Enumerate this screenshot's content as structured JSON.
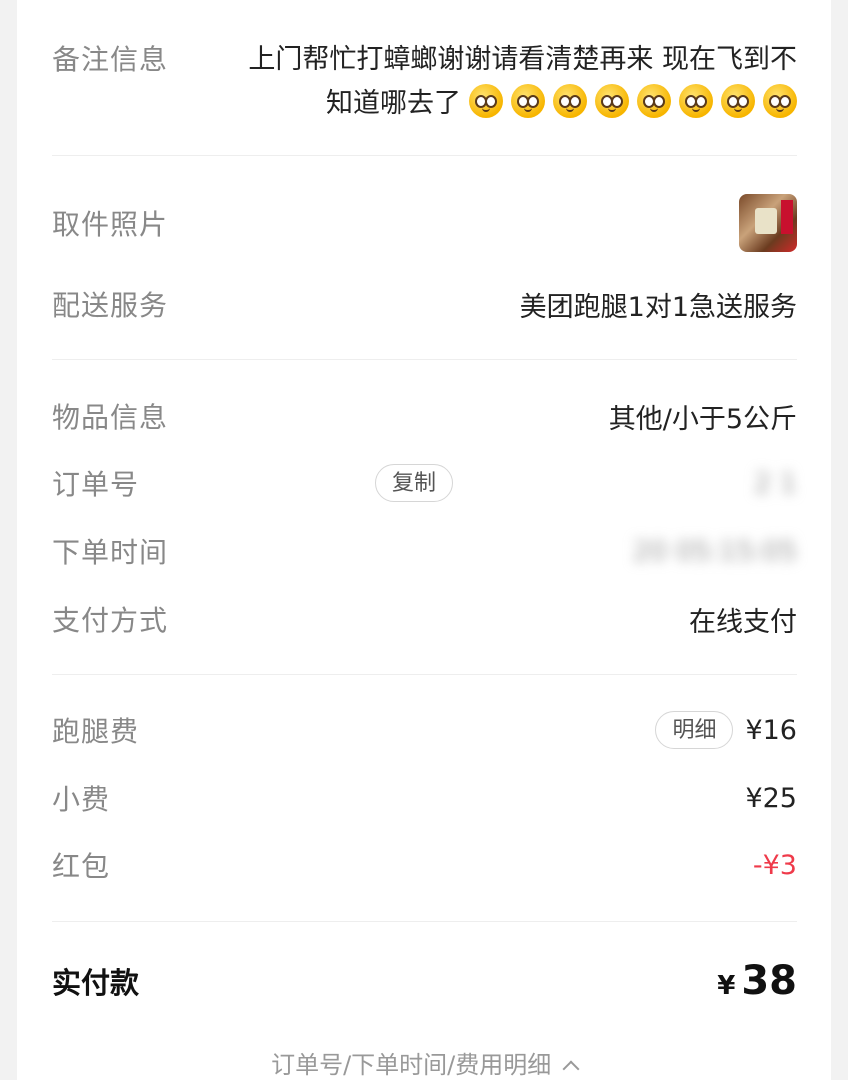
{
  "remark": {
    "label": "备注信息",
    "text_line1": "上门帮忙打蟑螂谢谢请看清楚再来 现在飞到不",
    "text_line2": "知道哪去了",
    "emoji_count": 8
  },
  "pickup_photo": {
    "label": "取件照片"
  },
  "delivery_service": {
    "label": "配送服务",
    "value": "美团跑腿1对1急送服务"
  },
  "item_info": {
    "label": "物品信息",
    "value": "其他/小于5公斤"
  },
  "order_number": {
    "label": "订单号",
    "copy_label": "复制",
    "value": "2 1"
  },
  "order_time": {
    "label": "下单时间",
    "value": "20 05:15:05"
  },
  "payment_method": {
    "label": "支付方式",
    "value": "在线支付"
  },
  "errand_fee": {
    "label": "跑腿费",
    "detail_label": "明细",
    "value": "¥16"
  },
  "tip": {
    "label": "小费",
    "value": "¥25"
  },
  "red_packet": {
    "label": "红包",
    "value": "-¥3",
    "color": "#ef3a4a"
  },
  "total": {
    "label": "实付款",
    "currency": "¥",
    "amount": "38"
  },
  "footer": {
    "text": "订单号/下单时间/费用明细",
    "icon": "chevron-up-icon"
  }
}
